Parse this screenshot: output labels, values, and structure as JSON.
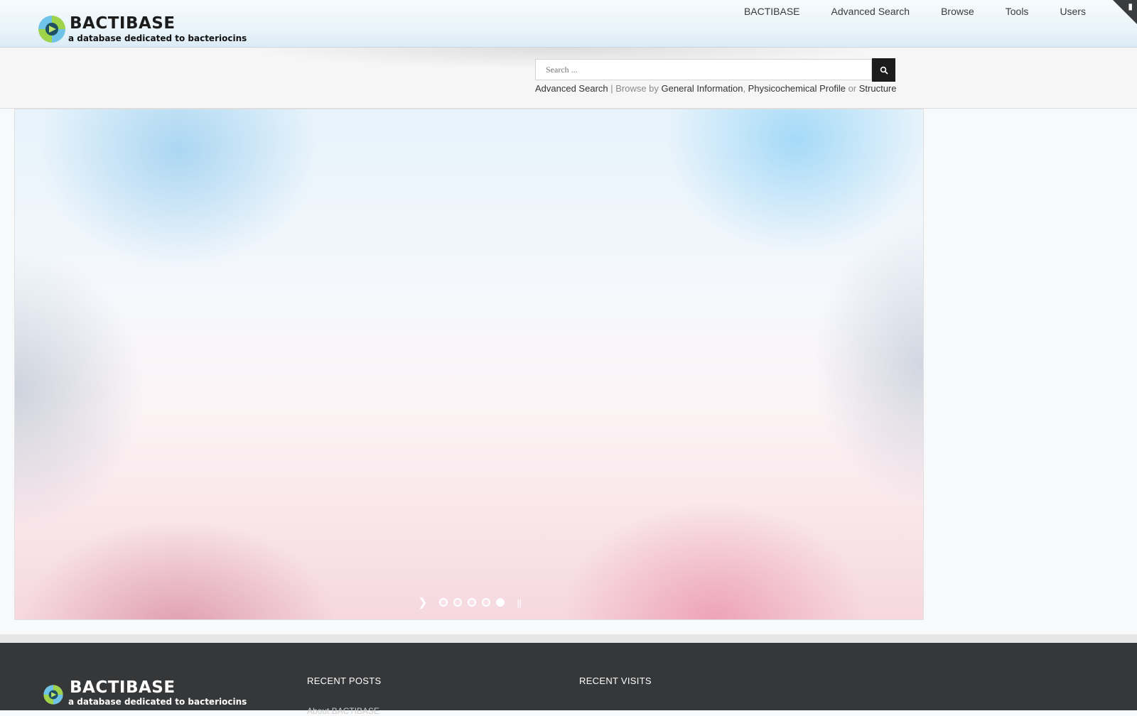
{
  "header": {
    "logo_name": "BACTIBASE",
    "logo_tagline": "a database dedicated to bacteriocins",
    "nav": [
      "BACTIBASE",
      "Advanced Search",
      "Browse",
      "Tools",
      "Users"
    ],
    "corner_icon": "login-icon"
  },
  "search": {
    "placeholder": "Search ...",
    "button_icon": "search-icon",
    "advanced_link": "Advanced Search",
    "separator": " | Browse by ",
    "browse_general": "General Information",
    "comma": ", ",
    "browse_physico": "Physicochemical Profile",
    "or_text": " or ",
    "browse_structure": "Structure"
  },
  "slider": {
    "slide_count": 5,
    "active_slide": 5,
    "next_icon": "chevron-right-icon",
    "pause_icon": "pause-icon"
  },
  "footer": {
    "logo_name": "BACTIBASE",
    "logo_tagline": "a database dedicated to bacteriocins",
    "recent_posts_title": "RECENT POSTS",
    "recent_posts_first": "About BACTIBASE",
    "recent_visits_title": "RECENT VISITS"
  },
  "colors": {
    "header_top": "#f7fbfd",
    "header_bottom": "#dcebf5",
    "footer_bg": "#363739",
    "search_button": "#1b1b1b"
  }
}
